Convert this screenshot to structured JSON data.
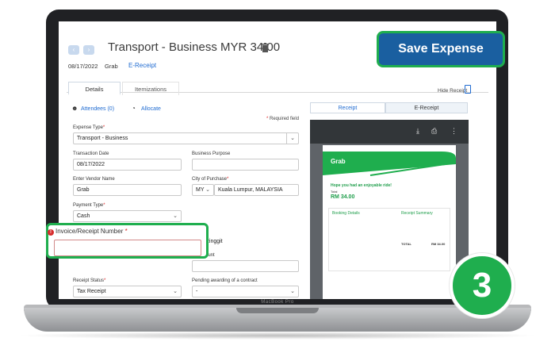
{
  "header": {
    "title": "Transport - Business MYR 34.00",
    "date": "08/17/2022",
    "vendor": "Grab",
    "ereceipt_link": "E-Receipt"
  },
  "tabs": [
    "Details",
    "Itemizations"
  ],
  "hide_receipt": "Hide Receipt",
  "links": {
    "attendees": "Attendees (0)",
    "allocate": "Allocate"
  },
  "required_note": "Required field",
  "form": {
    "expense_type": {
      "label": "Expense Type",
      "value": "Transport - Business"
    },
    "transaction_date": {
      "label": "Transaction Date",
      "value": "08/17/2022"
    },
    "business_purpose": {
      "label": "Business Purpose",
      "value": ""
    },
    "vendor_name": {
      "label": "Enter Vendor Name",
      "value": "Grab"
    },
    "city": {
      "label": "City of Purchase",
      "country": "MY",
      "value": "Kuala Lumpur, MALAYSIA"
    },
    "payment_type": {
      "label": "Payment Type",
      "value": "Cash"
    },
    "currency_partial": "sia, Ringgit",
    "amount_partial": "ed Amount",
    "receipt_status": {
      "label": "Receipt Status",
      "value": "Tax Receipt"
    },
    "pending_award": {
      "label": "Pending awarding of a contract",
      "value": "-"
    }
  },
  "invoice": {
    "label": "Invoice/Receipt Number",
    "value": ""
  },
  "receipt_tabs": [
    "Receipt",
    "E-Receipt"
  ],
  "receipt_doc": {
    "brand": "Grab",
    "headline": "Hope you had an enjoyable ride!",
    "total_label": "Total",
    "amount": "RM 34.00",
    "booking_details": "Booking Details",
    "receipt_summary": "Receipt Summary",
    "total_row": "TOTAL",
    "total_row_value": "RM 34.00"
  },
  "save_button": "Save Expense",
  "step_number": "3",
  "device_label": "MacBook Pro",
  "colors": {
    "brand_blue": "#1a5fa0",
    "callout_green": "#1fae4e",
    "link_blue": "#1f6bd1",
    "error_red": "#d62b2b"
  }
}
